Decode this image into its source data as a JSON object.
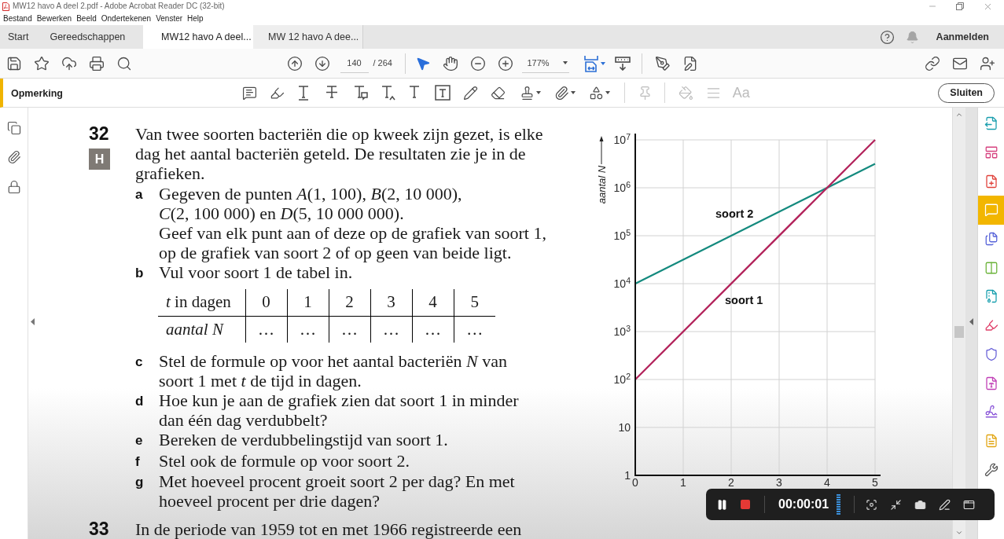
{
  "window": {
    "title": "MW12 havo A deel 2.pdf - Adobe Acrobat Reader DC (32-bit)"
  },
  "menu": [
    "Bestand",
    "Bewerken",
    "Beeld",
    "Ondertekenen",
    "Venster",
    "Help"
  ],
  "tabs": [
    {
      "label": "Start",
      "kind": "home",
      "selected": false
    },
    {
      "label": "Gereedschappen",
      "kind": "home",
      "selected": false
    },
    {
      "label": "MW12 havo A deel...",
      "kind": "document",
      "selected": true
    },
    {
      "label": "MW 12 havo A dee...",
      "kind": "document",
      "selected": false
    }
  ],
  "account": {
    "label": "Aanmelden"
  },
  "toolbar": {
    "page": "140",
    "page_total": "/ 264",
    "zoom": "177%",
    "tools": [
      {
        "kind": "select",
        "selected": true
      },
      {
        "kind": "hand",
        "selected": false
      }
    ]
  },
  "comment_bar": {
    "title": "Opmerking",
    "groups": [
      {
        "tools": [
          {
            "kind": "comment",
            "disabled": false
          },
          {
            "kind": "highlight",
            "disabled": false
          },
          {
            "kind": "underline",
            "disabled": false
          },
          {
            "kind": "strikethrough",
            "disabled": false
          },
          {
            "kind": "replace",
            "disabled": false
          },
          {
            "kind": "insert",
            "disabled": false
          },
          {
            "kind": "text",
            "disabled": false
          },
          {
            "kind": "text-box",
            "disabled": false
          },
          {
            "kind": "pencil",
            "disabled": false
          },
          {
            "kind": "eraser",
            "disabled": false
          },
          {
            "kind": "stamp",
            "disabled": false
          },
          {
            "kind": "attach",
            "disabled": false
          },
          {
            "kind": "shapes",
            "disabled": false
          }
        ]
      },
      {
        "tools": [
          {
            "kind": "pin",
            "disabled": true
          }
        ]
      },
      {
        "tools": [
          {
            "kind": "fill",
            "disabled": true
          },
          {
            "kind": "line-style",
            "disabled": true
          },
          {
            "kind": "font",
            "label": "Aa",
            "disabled": true
          }
        ]
      }
    ],
    "close": "Sluiten"
  },
  "right_panel": {
    "items": [
      {
        "kind": "export-pdf",
        "selected": false
      },
      {
        "kind": "edit-layout",
        "selected": false
      },
      {
        "kind": "create-pdf",
        "selected": false
      },
      {
        "kind": "comment",
        "selected": true
      },
      {
        "kind": "combine",
        "selected": false
      },
      {
        "kind": "organize",
        "selected": false
      },
      {
        "kind": "compress",
        "selected": false
      },
      {
        "kind": "redact",
        "selected": false
      },
      {
        "kind": "protect",
        "selected": false
      },
      {
        "kind": "forms",
        "selected": false
      },
      {
        "kind": "sign",
        "selected": false
      },
      {
        "kind": "send-comments",
        "selected": false
      },
      {
        "kind": "more-tools",
        "selected": false
      }
    ]
  },
  "document": {
    "exercise": {
      "number": "32",
      "badge": "H",
      "intro": "Van twee soorten bacteriën die op kweek zijn gezet, is elke dag het aantal bacteriën geteld. De resultaten zie je in de grafieken.",
      "items": [
        {
          "letter": "a",
          "paragraphs": [
            "Gegeven de punten *A*(1, 100), *B*(2, 10 000), *C*(2, 100 000) en *D*(5, 10 000 000).",
            "Geef van elk punt aan of deze op de grafiek van soort 1, op de grafiek van soort 2 of op geen van beide ligt."
          ]
        },
        {
          "letter": "b",
          "paragraphs": [
            "Vul voor soort 1 de tabel in."
          ],
          "table": {
            "header": {
              "label": "*t* in dagen",
              "cells": [
                "0",
                "1",
                "2",
                "3",
                "4",
                "5"
              ]
            },
            "rows": [
              {
                "label": "aantal N",
                "cells": [
                  "…",
                  "…",
                  "…",
                  "…",
                  "…",
                  "…"
                ]
              }
            ]
          }
        },
        {
          "letter": "c",
          "paragraphs": [
            "Stel de formule op voor het aantal bacteriën *N* van soort 1 met *t* de tijd in dagen."
          ]
        },
        {
          "letter": "d",
          "paragraphs": [
            "Hoe kun je aan de grafiek zien dat soort 1 in minder dan één dag verdubbelt?"
          ]
        },
        {
          "letter": "e",
          "paragraphs": [
            "Bereken de verdubbelingstijd van soort 1."
          ]
        },
        {
          "letter": "f",
          "paragraphs": [
            "Stel ook de formule op voor soort 2."
          ]
        },
        {
          "letter": "g",
          "paragraphs": [
            "Met hoeveel procent groeit soort 2 per dag? En met hoeveel procent per drie dagen?"
          ]
        }
      ]
    },
    "next_exercise": {
      "number": "33",
      "text": "In de periode van 1959 tot en met 1966 registreerde een"
    },
    "chart": {
      "ylabel": "aantal N",
      "y_labels": [
        "10$^{7}$",
        "10$^{6}$",
        "10$^{5}$",
        "10$^{4}$",
        "10$^{3}$",
        "10$^{2}$",
        "10",
        "1"
      ],
      "x_labels": [
        "0",
        "1",
        "2",
        "3",
        "4",
        "5"
      ],
      "lines": [
        {
          "name": "soort 2",
          "color": "#148a7e"
        },
        {
          "name": "soort 1",
          "color": "#b3245c"
        }
      ]
    }
  },
  "recorder": {
    "time": "00:00:01"
  }
}
